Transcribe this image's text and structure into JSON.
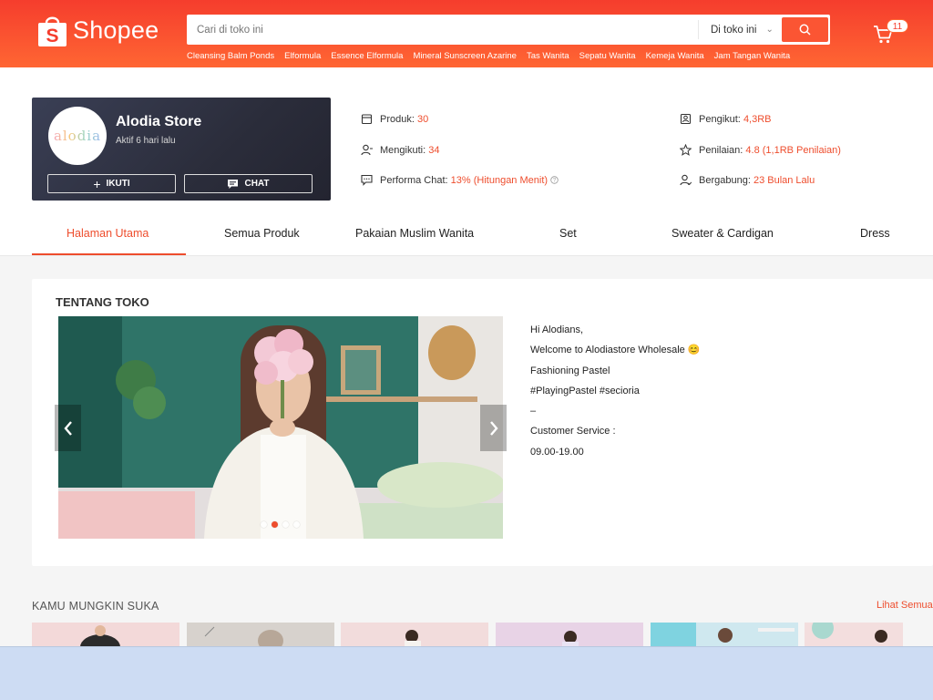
{
  "header": {
    "logo_text": "Shopee",
    "search_placeholder": "Cari di toko ini",
    "search_scope": "Di toko ini",
    "suggestions": [
      "Cleansing Balm Ponds",
      "Elformula",
      "Essence Elformula",
      "Mineral Sunscreen Azarine",
      "Tas Wanita",
      "Sepatu Wanita",
      "Kemeja Wanita",
      "Jam Tangan Wanita"
    ],
    "cart_count": "11"
  },
  "shop": {
    "avatar_text": "alodia",
    "name": "Alodia Store",
    "status": "Aktif 6 hari lalu",
    "follow_label": "IKUTI",
    "chat_label": "CHAT"
  },
  "stats": {
    "products": {
      "label": "Produk:",
      "value": "30"
    },
    "following": {
      "label": "Mengikuti:",
      "value": "34"
    },
    "chat_perf": {
      "label": "Performa Chat:",
      "value": "13% (Hitungan Menit)"
    },
    "followers": {
      "label": "Pengikut:",
      "value": "4,3RB"
    },
    "rating": {
      "label": "Penilaian:",
      "value": "4.8 (1,1RB Penilaian)"
    },
    "joined": {
      "label": "Bergabung:",
      "value": "23 Bulan Lalu"
    }
  },
  "tabs": [
    {
      "label": "Halaman Utama",
      "active": true
    },
    {
      "label": "Semua Produk"
    },
    {
      "label": "Pakaian Muslim Wanita"
    },
    {
      "label": "Set"
    },
    {
      "label": "Sweater & Cardigan"
    },
    {
      "label": "Dress"
    }
  ],
  "about": {
    "title": "TENTANG TOKO",
    "carousel_active_index": 1,
    "carousel_count": 4,
    "lines": [
      "Hi Alodians,",
      "Welcome to Alodiastore Wholesale 😊",
      "Fashioning Pastel",
      "#PlayingPastel #secioria",
      "–",
      "Customer Service :",
      "09.00-19.00"
    ]
  },
  "recommended": {
    "title": "KAMU MUNGKIN SUKA",
    "more_label": "Lihat Semua"
  },
  "colors": {
    "brand": "#ee4d2d",
    "header_gradient": [
      "#f53d2d",
      "#ff6633"
    ]
  }
}
